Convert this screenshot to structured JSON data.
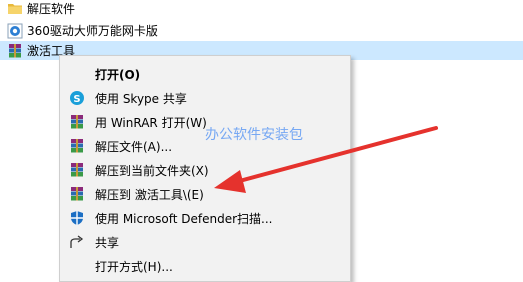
{
  "files": [
    {
      "label": "解压软件",
      "icon": "folder-icon"
    },
    {
      "label": "360驱动大师万能网卡版",
      "icon": "installer-icon"
    },
    {
      "label": "激活工具",
      "icon": "winrar-archive-icon"
    }
  ],
  "context_menu": {
    "items": [
      {
        "label": "打开(O)",
        "icon": ""
      },
      {
        "label": "使用 Skype 共享",
        "icon": "skype-icon"
      },
      {
        "label": "用 WinRAR 打开(W)",
        "icon": "winrar-icon"
      },
      {
        "label": "解压文件(A)...",
        "icon": "winrar-icon"
      },
      {
        "label": "解压到当前文件夹(X)",
        "icon": "winrar-icon"
      },
      {
        "label": "解压到 激活工具\\(E)",
        "icon": "winrar-icon"
      },
      {
        "label": "使用 Microsoft Defender扫描...",
        "icon": "defender-shield-icon"
      },
      {
        "label": "共享",
        "icon": "share-icon"
      },
      {
        "label": "打开方式(H)...",
        "icon": ""
      }
    ]
  },
  "watermark": "办公软件安装包",
  "colors": {
    "selection": "#cce8ff",
    "menu_bg": "#f2f2f2",
    "arrow": "#e5322d",
    "watermark": "#6aa0f4"
  }
}
